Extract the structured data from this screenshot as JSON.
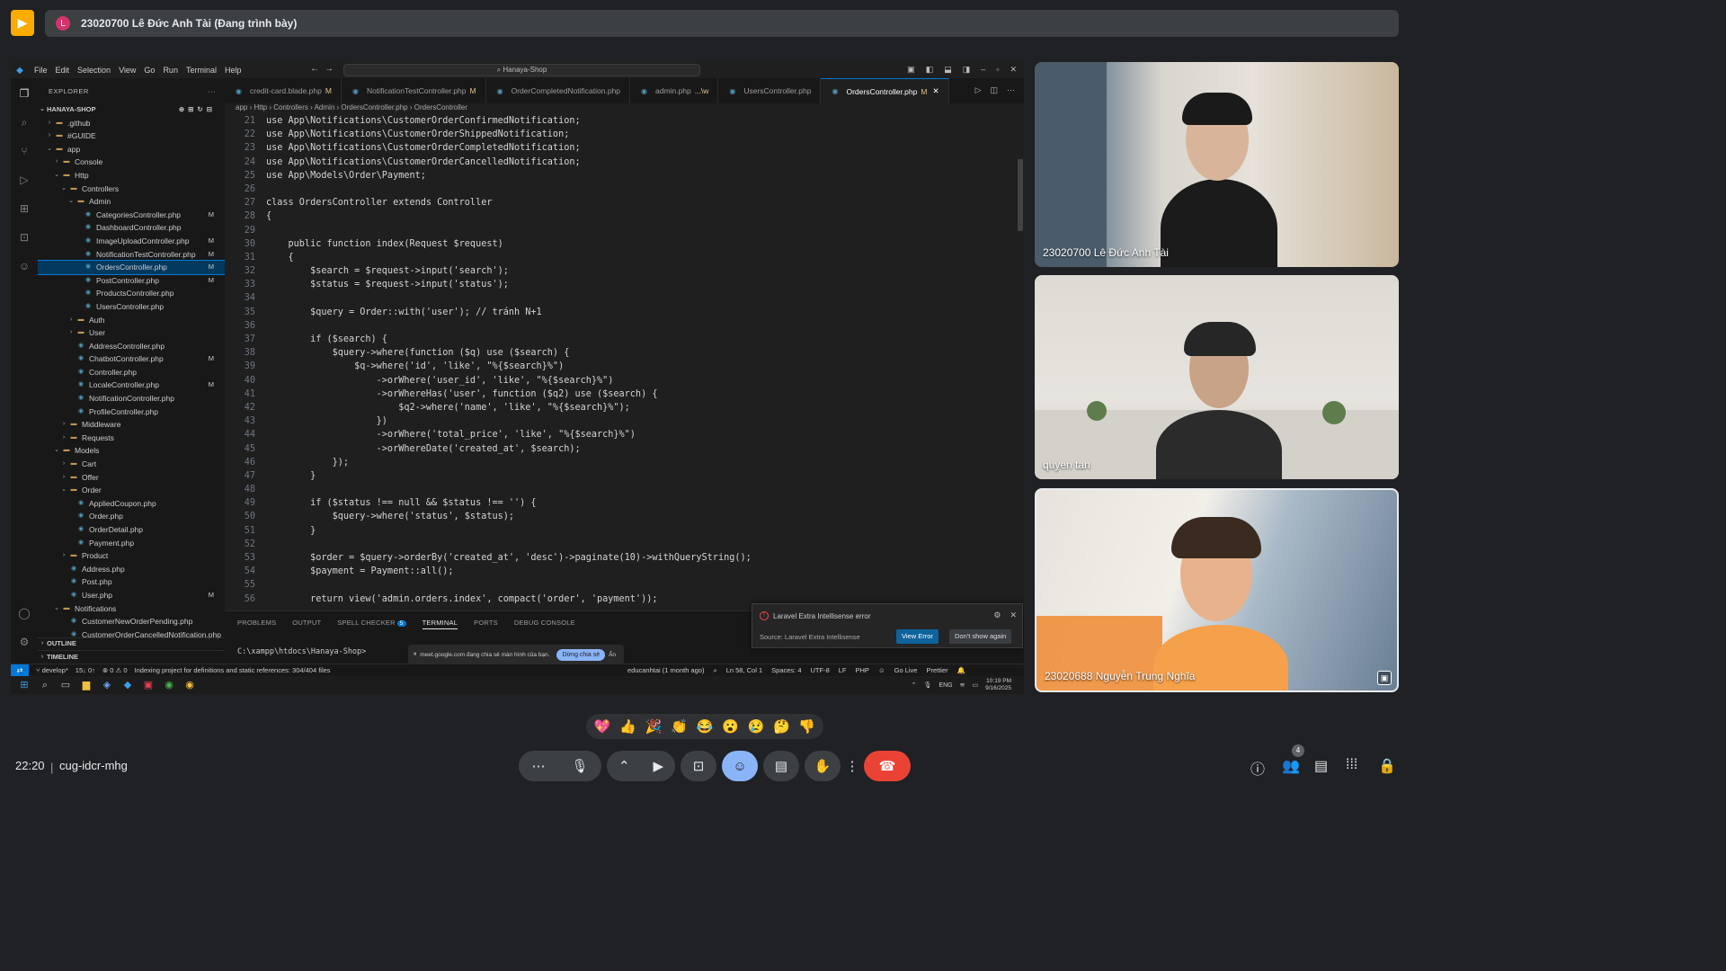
{
  "presenting": {
    "avatar_letter": "L",
    "text": "23020700 Lê Đức Anh Tài (Đang trình bày)"
  },
  "vscode": {
    "menu": [
      "File",
      "Edit",
      "Selection",
      "View",
      "Go",
      "Run",
      "Terminal",
      "Help"
    ],
    "search": "Hanaya-Shop",
    "explorer_title": "EXPLORER",
    "root": "HANAYA-SHOP",
    "tree": [
      {
        "label": ".github",
        "depth": 1,
        "arrow": "›",
        "type": "folder",
        "badge": ""
      },
      {
        "label": "#GUIDE",
        "depth": 1,
        "arrow": "›",
        "type": "folder",
        "badge": ""
      },
      {
        "label": "app",
        "depth": 1,
        "arrow": "⌄",
        "type": "folder",
        "badge": ""
      },
      {
        "label": "Console",
        "depth": 2,
        "arrow": "›",
        "type": "folder",
        "badge": ""
      },
      {
        "label": "Http",
        "depth": 2,
        "arrow": "⌄",
        "type": "folder",
        "badge": ""
      },
      {
        "label": "Controllers",
        "depth": 3,
        "arrow": "⌄",
        "type": "folder",
        "badge": ""
      },
      {
        "label": "Admin",
        "depth": 4,
        "arrow": "⌄",
        "type": "folder",
        "badge": ""
      },
      {
        "label": "CategoriesController.php",
        "depth": 5,
        "arrow": "",
        "type": "php",
        "badge": "M"
      },
      {
        "label": "DashboardController.php",
        "depth": 5,
        "arrow": "",
        "type": "php",
        "badge": ""
      },
      {
        "label": "ImageUploadController.php",
        "depth": 5,
        "arrow": "",
        "type": "php",
        "badge": "M"
      },
      {
        "label": "NotificationTestController.php",
        "depth": 5,
        "arrow": "",
        "type": "php",
        "badge": "M"
      },
      {
        "label": "OrdersController.php",
        "depth": 5,
        "arrow": "",
        "type": "php",
        "badge": "M",
        "selected": true
      },
      {
        "label": "PostController.php",
        "depth": 5,
        "arrow": "",
        "type": "php",
        "badge": "M"
      },
      {
        "label": "ProductsController.php",
        "depth": 5,
        "arrow": "",
        "type": "php",
        "badge": ""
      },
      {
        "label": "UsersController.php",
        "depth": 5,
        "arrow": "",
        "type": "php",
        "badge": ""
      },
      {
        "label": "Auth",
        "depth": 4,
        "arrow": "›",
        "type": "folder",
        "badge": ""
      },
      {
        "label": "User",
        "depth": 4,
        "arrow": "›",
        "type": "folder",
        "badge": ""
      },
      {
        "label": "AddressController.php",
        "depth": 4,
        "arrow": "",
        "type": "php",
        "badge": ""
      },
      {
        "label": "ChatbotController.php",
        "depth": 4,
        "arrow": "",
        "type": "php",
        "badge": "M"
      },
      {
        "label": "Controller.php",
        "depth": 4,
        "arrow": "",
        "type": "php",
        "badge": ""
      },
      {
        "label": "LocaleController.php",
        "depth": 4,
        "arrow": "",
        "type": "php",
        "badge": "M"
      },
      {
        "label": "NotificationController.php",
        "depth": 4,
        "arrow": "",
        "type": "php",
        "badge": ""
      },
      {
        "label": "ProfileController.php",
        "depth": 4,
        "arrow": "",
        "type": "php",
        "badge": ""
      },
      {
        "label": "Middleware",
        "depth": 3,
        "arrow": "›",
        "type": "folder",
        "badge": ""
      },
      {
        "label": "Requests",
        "depth": 3,
        "arrow": "›",
        "type": "folder",
        "badge": ""
      },
      {
        "label": "Models",
        "depth": 2,
        "arrow": "⌄",
        "type": "folder",
        "badge": ""
      },
      {
        "label": "Cart",
        "depth": 3,
        "arrow": "›",
        "type": "folder",
        "badge": ""
      },
      {
        "label": "Offer",
        "depth": 3,
        "arrow": "›",
        "type": "folder",
        "badge": ""
      },
      {
        "label": "Order",
        "depth": 3,
        "arrow": "⌄",
        "type": "folder",
        "badge": ""
      },
      {
        "label": "AppliedCoupon.php",
        "depth": 4,
        "arrow": "",
        "type": "php",
        "badge": ""
      },
      {
        "label": "Order.php",
        "depth": 4,
        "arrow": "",
        "type": "php",
        "badge": ""
      },
      {
        "label": "OrderDetail.php",
        "depth": 4,
        "arrow": "",
        "type": "php",
        "badge": ""
      },
      {
        "label": "Payment.php",
        "depth": 4,
        "arrow": "",
        "type": "php",
        "badge": ""
      },
      {
        "label": "Product",
        "depth": 3,
        "arrow": "›",
        "type": "folder",
        "badge": ""
      },
      {
        "label": "Address.php",
        "depth": 3,
        "arrow": "",
        "type": "php",
        "badge": ""
      },
      {
        "label": "Post.php",
        "depth": 3,
        "arrow": "",
        "type": "php",
        "badge": ""
      },
      {
        "label": "User.php",
        "depth": 3,
        "arrow": "",
        "type": "php",
        "badge": "M"
      },
      {
        "label": "Notifications",
        "depth": 2,
        "arrow": "⌄",
        "type": "folder",
        "badge": ""
      },
      {
        "label": "CustomerNewOrderPending.php",
        "depth": 3,
        "arrow": "",
        "type": "php",
        "badge": ""
      },
      {
        "label": "CustomerOrderCancelledNotification.php",
        "depth": 3,
        "arrow": "",
        "type": "php",
        "badge": ""
      }
    ],
    "outline": "OUTLINE",
    "timeline": "TIMELINE",
    "tabs": [
      {
        "label": "credit-card.blade.php",
        "mod": "M",
        "active": false
      },
      {
        "label": "NotificationTestController.php",
        "mod": "M",
        "active": false
      },
      {
        "label": "OrderCompletedNotification.php",
        "mod": "",
        "active": false
      },
      {
        "label": "admin.php",
        "mod": "...\\w",
        "active": false
      },
      {
        "label": "UsersController.php",
        "mod": "",
        "active": false
      },
      {
        "label": "OrdersController.php",
        "mod": "M",
        "active": true
      }
    ],
    "breadcrumb": "app › Http › Controllers › Admin › OrdersController.php › OrdersController",
    "code": [
      {
        "n": "21",
        "t": "use App\\Notifications\\CustomerOrderConfirmedNotification;"
      },
      {
        "n": "22",
        "t": "use App\\Notifications\\CustomerOrderShippedNotification;"
      },
      {
        "n": "23",
        "t": "use App\\Notifications\\CustomerOrderCompletedNotification;"
      },
      {
        "n": "24",
        "t": "use App\\Notifications\\CustomerOrderCancelledNotification;"
      },
      {
        "n": "25",
        "t": "use App\\Models\\Order\\Payment;"
      },
      {
        "n": "26",
        "t": ""
      },
      {
        "n": "27",
        "t": "class OrdersController extends Controller"
      },
      {
        "n": "28",
        "t": "{"
      },
      {
        "n": "29",
        "t": ""
      },
      {
        "n": "30",
        "t": "    public function index(Request $request)"
      },
      {
        "n": "31",
        "t": "    {"
      },
      {
        "n": "32",
        "t": "        $search = $request->input('search');"
      },
      {
        "n": "33",
        "t": "        $status = $request->input('status');"
      },
      {
        "n": "34",
        "t": ""
      },
      {
        "n": "35",
        "t": "        $query = Order::with('user'); // tránh N+1"
      },
      {
        "n": "36",
        "t": ""
      },
      {
        "n": "37",
        "t": "        if ($search) {"
      },
      {
        "n": "38",
        "t": "            $query->where(function ($q) use ($search) {"
      },
      {
        "n": "39",
        "t": "                $q->where('id', 'like', \"%{$search}%\")"
      },
      {
        "n": "40",
        "t": "                    ->orWhere('user_id', 'like', \"%{$search}%\")"
      },
      {
        "n": "41",
        "t": "                    ->orWhereHas('user', function ($q2) use ($search) {"
      },
      {
        "n": "42",
        "t": "                        $q2->where('name', 'like', \"%{$search}%\");"
      },
      {
        "n": "43",
        "t": "                    })"
      },
      {
        "n": "44",
        "t": "                    ->orWhere('total_price', 'like', \"%{$search}%\")"
      },
      {
        "n": "45",
        "t": "                    ->orWhereDate('created_at', $search);"
      },
      {
        "n": "46",
        "t": "            });"
      },
      {
        "n": "47",
        "t": "        }"
      },
      {
        "n": "48",
        "t": ""
      },
      {
        "n": "49",
        "t": "        if ($status !== null && $status !== '') {"
      },
      {
        "n": "50",
        "t": "            $query->where('status', $status);"
      },
      {
        "n": "51",
        "t": "        }"
      },
      {
        "n": "52",
        "t": ""
      },
      {
        "n": "53",
        "t": "        $order = $query->orderBy('created_at', 'desc')->paginate(10)->withQueryString();"
      },
      {
        "n": "54",
        "t": "        $payment = Payment::all();"
      },
      {
        "n": "55",
        "t": ""
      },
      {
        "n": "56",
        "t": "        return view('admin.orders.index', compact('order', 'payment'));"
      }
    ],
    "panel_tabs": [
      "PROBLEMS",
      "OUTPUT",
      "SPELL CHECKER",
      "TERMINAL",
      "PORTS",
      "DEBUG CONSOLE"
    ],
    "spell_count": "5",
    "terminal_prompt": "C:\\xampp\\htdocs\\Hanaya-Shop>",
    "toast": {
      "title": "Laravel Extra Intellisense error",
      "source": "Source: Laravel Extra Intellisense",
      "primary": "View Error",
      "secondary": "Don't show again"
    },
    "share_bar": {
      "text": "meet.google.com đang chia sẻ màn hình của bạn.",
      "button": "Dừng chia sẻ",
      "hide": "Ẩn"
    },
    "status": {
      "branch": "develop*",
      "sync": "15↓ 0↑",
      "problems": "⊗ 0 ⚠ 0",
      "indexing": "Indexing project for definitions and static references: 304/404 files",
      "blame": "educanhtai (1 month ago)",
      "position": "Ln 58, Col 1",
      "spaces": "Spaces: 4",
      "encoding": "UTF-8",
      "eol": "LF",
      "language": "PHP",
      "golive": "Go Live",
      "prettier": "Prettier"
    },
    "taskbar": {
      "lang": "ENG",
      "time": "10:19 PM",
      "date": "9/16/2025"
    }
  },
  "participants": [
    {
      "name": "23020700 Lê Đức Anh Tài"
    },
    {
      "name": "quyen tan"
    },
    {
      "name": "23020688 Nguyễn Trung Nghĩa"
    }
  ],
  "reactions": [
    "💖",
    "👍",
    "🎉",
    "👏",
    "😂",
    "😮",
    "😢",
    "🤔",
    "👎"
  ],
  "meeting": {
    "time": "22:20",
    "code": "cug-idcr-mhg",
    "people_count": "4"
  },
  "colors": {
    "accent": "#8ab4f8",
    "end_call": "#ea4335",
    "vscode_blue": "#0078d4"
  }
}
